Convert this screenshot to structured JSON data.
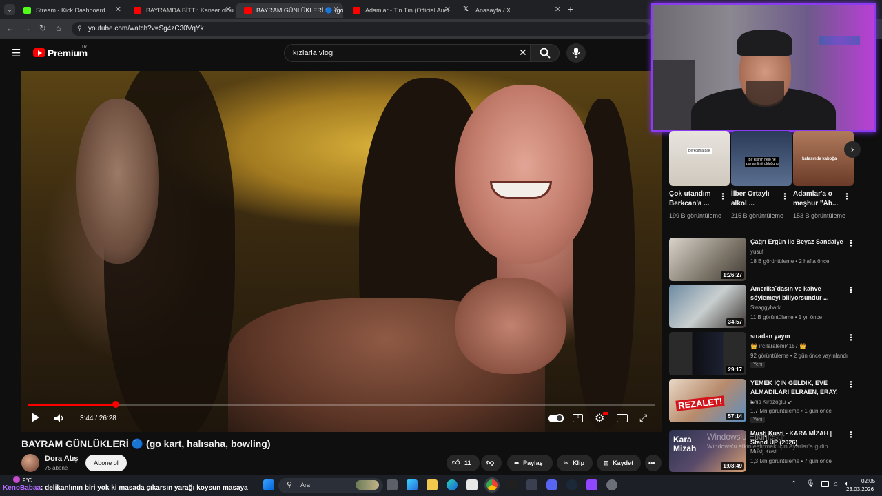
{
  "browser": {
    "tabs": [
      {
        "label": "Stream - Kick Dashboard",
        "color": "#53fc18"
      },
      {
        "label": "BAYRAMDA BİTTİ: Kanser oldu",
        "color": "#ff0000"
      },
      {
        "label": "BAYRAM GÜNLÜKLERİ 🔵 (go k",
        "color": "#ff0000"
      },
      {
        "label": "Adamlar - Tin Tın (Official Audi",
        "color": "#ff0000"
      },
      {
        "label": "Anasayfa / X",
        "color": "#ffffff"
      }
    ],
    "new_tab": "+",
    "url": "youtube.com/watch?v=Sg4zC30VqYk"
  },
  "youtube": {
    "logo_text": "Premium",
    "logo_region": "TR",
    "search_value": "kızlarla vlog"
  },
  "player": {
    "time": "3:44 / 26:28",
    "progress_fraction": 0.141
  },
  "video": {
    "title": "BAYRAM GÜNLÜKLERİ 🔵 (go kart, halısaha, bowling)",
    "channel": "Dora Atış",
    "subscribers": "75 abone",
    "subscribe_label": "Abone ol",
    "likes": "11",
    "share_label": "Paylaş",
    "clip_label": "Klip",
    "save_label": "Kaydet"
  },
  "shorts": [
    {
      "title": "Çok utandım Berkcan'a ...",
      "views": "199 B görüntüleme",
      "caption": "Berkcan'a bak"
    },
    {
      "title": "İlber Ortaylı alkol ...",
      "views": "215 B görüntüleme",
      "caption": "Bir kişinin nelo ne zaman limit olduğunu"
    },
    {
      "title": "Adamlar'a o meşhur \"Ab...",
      "views": "153 B görüntüleme",
      "caption": "kafasında kaboğa"
    }
  ],
  "recommendations": [
    {
      "title": "Çağrı Ergün ile Beyaz Sandalye",
      "channel": "yusuf",
      "meta": "18 B görüntüleme • 2 hafta önce",
      "duration": "1:26:27",
      "badge": ""
    },
    {
      "title": "Amerika`dasın ve kahve söylemeyi biliyorsundur ...",
      "channel": "Swaggybark",
      "meta": "11 B görüntüleme • 1 yıl önce",
      "duration": "34:57",
      "badge": ""
    },
    {
      "title": "sıradan yayın",
      "channel": "👑 ırcılaralemi4157 👑",
      "meta": "92 görüntüleme • 2 gün önce yayınlandı",
      "duration": "29:17",
      "badge": "Yeni"
    },
    {
      "title": "YEMEK İÇİN GELDİK, EVE ALMADILAR! ELRAEN, ERAY, ...",
      "channel": "Enis Kirazoglu",
      "meta": "1,7 Mn görüntüleme • 1 gün önce",
      "duration": "57:14",
      "badge": "Yeni",
      "thumb_text": "REZALET!"
    },
    {
      "title": "Mustj Kusti - KARA MİZAH | Stand UP (2026)",
      "channel": "Mustj Kusti",
      "meta": "1,3 Mn görüntüleme • 7 gün önce",
      "duration": "1:08:49",
      "badge": "",
      "thumb_text": "Kara Mizah"
    }
  ],
  "windows_watermark": {
    "line1": "Windows'u Etkinleştir",
    "line2": "Windows'u etkinleştirmek için Ayarlar'a gidin."
  },
  "taskbar": {
    "weather": "9°C",
    "ticker_user": "KenoBabaa",
    "ticker_text": ": delikanlının biri yok ki masada çıkarsın yarağı koysun masaya",
    "search_placeholder": "Ara",
    "time": "02:05",
    "date": "23.03.2026"
  }
}
